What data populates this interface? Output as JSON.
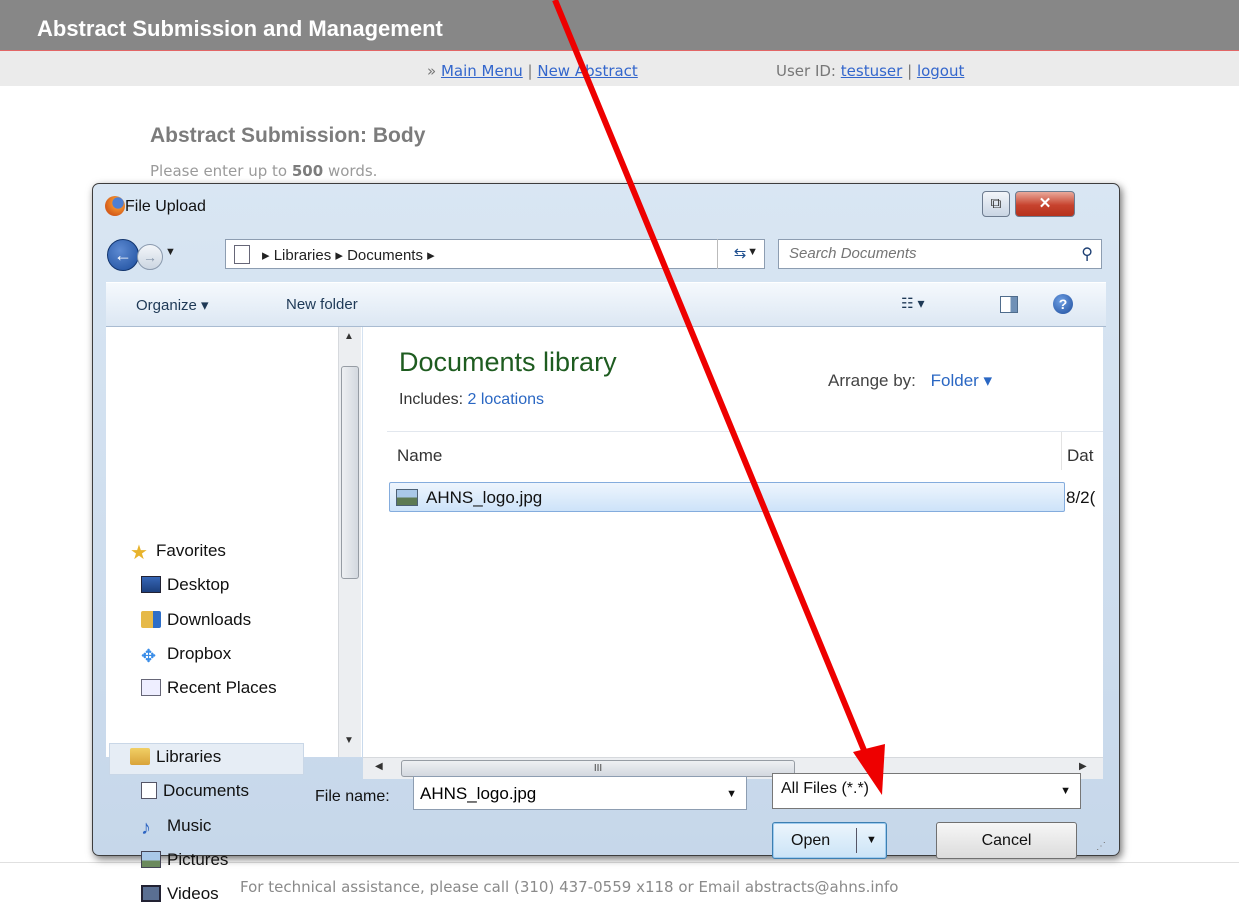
{
  "site": {
    "title": "Abstract Submission and Management",
    "nav": {
      "prefix": "»",
      "main_menu": "Main Menu",
      "separator": "|",
      "new_abstract": "New Abstract",
      "user_label": "User ID:",
      "user_id": "testuser",
      "user_sep": "|",
      "logout": "logout"
    },
    "heading": "Abstract Submission: Body",
    "instructions_pre": "Please enter up to",
    "instructions_num": "500",
    "instructions_post": "words.",
    "footer": "For technical assistance, please call (310) 437-0559 x118 or Email abstracts@ahns.info"
  },
  "dialog": {
    "title": "File Upload",
    "address": "▸ Libraries ▸ Documents ▸",
    "search_placeholder": "Search Documents",
    "toolbar": {
      "organize": "Organize ▾",
      "new_folder": "New folder",
      "views": "☷ ▾",
      "help": "?"
    },
    "nav_items": [
      {
        "label": "Favorites"
      },
      {
        "label": "Desktop"
      },
      {
        "label": "Downloads"
      },
      {
        "label": "Dropbox"
      },
      {
        "label": "Recent Places"
      },
      {
        "label": "Libraries"
      },
      {
        "label": "Documents"
      },
      {
        "label": "Music"
      },
      {
        "label": "Pictures"
      },
      {
        "label": "Videos"
      }
    ],
    "library_title": "Documents library",
    "includes_label": "Includes:",
    "includes_link": "2 locations",
    "arrange_label": "Arrange by:",
    "arrange_value": "Folder ▾",
    "columns": {
      "name": "Name",
      "date": "Dat"
    },
    "files": [
      {
        "name": "AHNS_logo.jpg",
        "date": "8/2("
      }
    ],
    "file_name_label": "File name:",
    "file_name_value": "AHNS_logo.jpg",
    "file_type": "All Files (*.*)",
    "open_label": "Open",
    "cancel_label": "Cancel",
    "scroll_grip": "III"
  },
  "colors": {
    "header_bg": "#878787",
    "link": "#3366cc",
    "dialog_frame": "#c6d7ea",
    "annotation_arrow": "#ee0000"
  }
}
